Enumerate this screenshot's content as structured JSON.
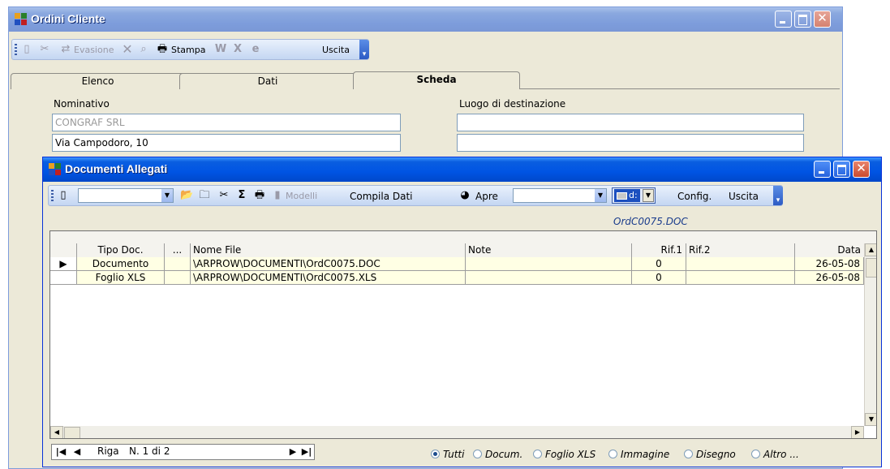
{
  "back_window": {
    "title": "Ordini Cliente",
    "toolbar": {
      "evasione": "Evasione",
      "stampa": "Stampa",
      "uscita": "Uscita"
    },
    "tabs": [
      "Elenco",
      "Dati",
      "Scheda"
    ],
    "active_tab": "Scheda",
    "labels": {
      "nominativo": "Nominativo",
      "luogo": "Luogo di destinazione"
    },
    "fields": {
      "nominativo": "CONGRAF SRL",
      "indirizzo": "Via Campodoro, 10"
    }
  },
  "front_window": {
    "title": "Documenti Allegati",
    "toolbar": {
      "modelli": "Modelli",
      "compila": "Compila Dati",
      "apre": "Apre",
      "drive": "d:",
      "config": "Config.",
      "uscita": "Uscita"
    },
    "current_file": "OrdC0075.DOC",
    "columns": [
      "Tipo Doc.",
      "...",
      "Nome File",
      "Note",
      "Rif.1",
      "Rif.2",
      "Data"
    ],
    "rows": [
      {
        "tipo": "Documento",
        "file": "\\ARPROW\\DOCUMENTI\\OrdC0075.DOC",
        "note": "",
        "rif1": "0",
        "rif2": "",
        "data": "26-05-08"
      },
      {
        "tipo": "Foglio XLS",
        "file": "\\ARPROW\\DOCUMENTI\\OrdC0075.XLS",
        "note": "",
        "rif1": "0",
        "rif2": "",
        "data": "26-05-08"
      }
    ],
    "nav": {
      "riga": "Riga",
      "counter": "N. 1 di 2"
    },
    "filters": [
      "Tutti",
      "Docum.",
      "Foglio XLS",
      "Immagine",
      "Disegno",
      "Altro ..."
    ],
    "selected_filter": "Tutti"
  },
  "colors": {
    "xp_blue": "#0054e3",
    "face": "#ece9d8",
    "cell_bg": "#ffffe4",
    "filename_blue": "#1a3c8c"
  }
}
